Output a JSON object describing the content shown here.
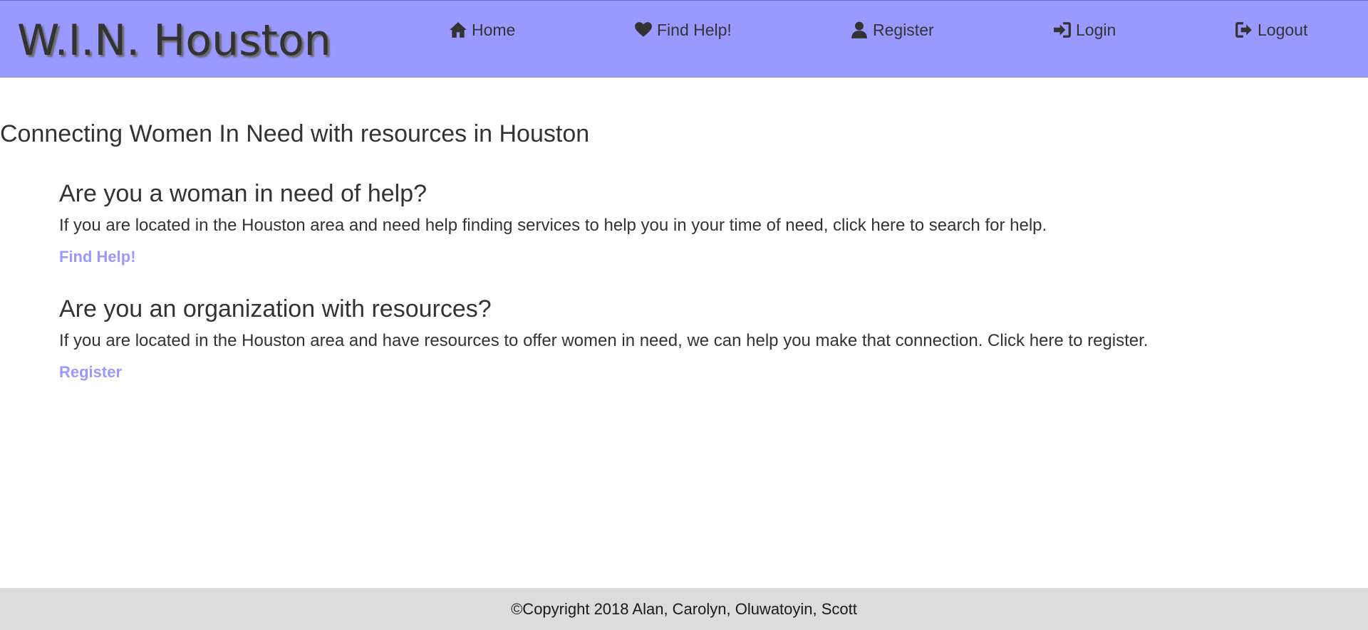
{
  "header": {
    "brand": "W.I.N. Houston",
    "nav": {
      "home": "Home",
      "find_help": "Find Help!",
      "register": "Register",
      "login": "Login",
      "logout": "Logout"
    },
    "icons": {
      "home": "home-icon",
      "find_help": "heart-icon",
      "register": "user-icon",
      "login": "login-icon",
      "logout": "logout-icon"
    },
    "background_color": "#9999ff"
  },
  "main": {
    "tagline": "Connecting Women In Need with resources in Houston",
    "sections": [
      {
        "heading": "Are you a woman in need of help?",
        "body": "If you are located in the Houston area and need help finding services to help you in your time of need, click here to search for help.",
        "link": "Find Help!"
      },
      {
        "heading": "Are you an organization with resources?",
        "body": "If you are located in the Houston area and have resources to offer women in need, we can help you make that connection. Click here to register.",
        "link": "Register"
      }
    ],
    "link_color": "#9999ff"
  },
  "footer": {
    "copyright": "©Copyright 2018 Alan, Carolyn, Oluwatoyin, Scott"
  }
}
